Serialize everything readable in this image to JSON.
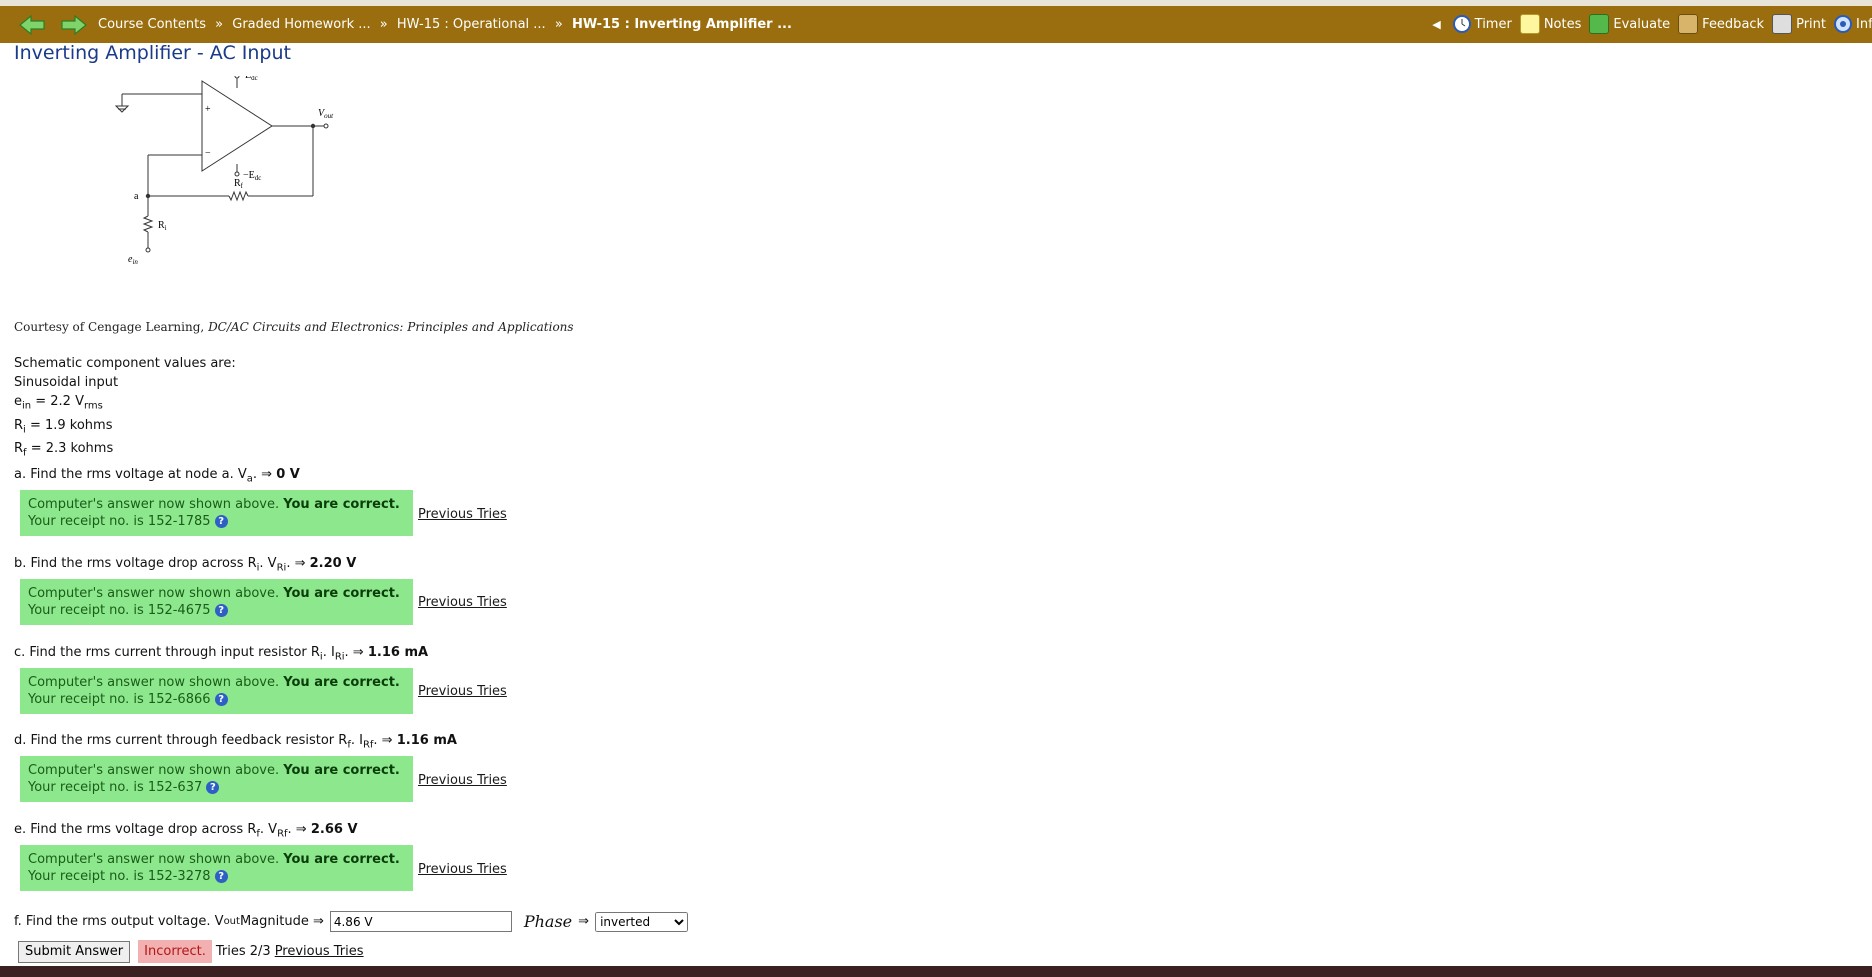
{
  "nav": {
    "breadcrumbs": [
      "Course Contents",
      "Graded Homework ...",
      "HW-15 : Operational ...",
      "HW-15 : Inverting Amplifier ..."
    ],
    "separator": "»",
    "tools": [
      "Timer",
      "Notes",
      "Evaluate",
      "Feedback",
      "Print",
      "Info"
    ]
  },
  "page": {
    "title": "Inverting Amplifier - AC Input"
  },
  "schematic": {
    "edc": "E",
    "edc_sub": "dc",
    "neg_edc": "−E",
    "neg_edc_sub": "dc",
    "vout": "V",
    "vout_sub": "out",
    "rf": "R",
    "rf_sub": "f",
    "ri": "R",
    "ri_sub": "i",
    "node_a": "a",
    "ein": "e",
    "ein_sub": "in",
    "plus": "+",
    "minus": "−"
  },
  "courtesy": {
    "prefix": "Courtesy of Cengage Learning,",
    "book": "DC/AC Circuits and Electronics: Principles and Applications"
  },
  "values": {
    "heading": "Schematic component values are:",
    "sinusoidal": "Sinusoidal input",
    "ein_label": "e",
    "ein_sub": "in",
    "ein_val": " = 2.2 V",
    "ein_unit": "rms",
    "ri_label": "R",
    "ri_sub": "i",
    "ri_val": " = 1.9 kohms",
    "rf_label": "R",
    "rf_sub": "f",
    "rf_val": " = 2.3 kohms"
  },
  "questions": [
    {
      "pre": "a. Find the rms voltage at node a. V",
      "sub1": "a",
      "mid": "",
      "sub2": "",
      "post": ". ⇒",
      "answer": "0 V",
      "receipt": "Your receipt no. is 152-1785"
    },
    {
      "pre": "b. Find the rms voltage drop across R",
      "sub1": "i",
      "mid": ". V",
      "sub2": "Ri",
      "post": ". ⇒",
      "answer": "2.20 V",
      "receipt": "Your receipt no. is 152-4675"
    },
    {
      "pre": "c. Find the rms current through input resistor R",
      "sub1": "i",
      "mid": ". I",
      "sub2": "Ri",
      "post": ". ⇒",
      "answer": "1.16 mA",
      "receipt": "Your receipt no. is 152-6866"
    },
    {
      "pre": "d. Find the rms current through feedback resistor R",
      "sub1": "f",
      "mid": ". I",
      "sub2": "Rf",
      "post": ". ⇒",
      "answer": "1.16 mA",
      "receipt": "Your receipt no. is 152-637"
    },
    {
      "pre": "e. Find the rms voltage drop across R",
      "sub1": "f",
      "mid": ". V",
      "sub2": "Rf",
      "post": ". ⇒",
      "answer": "2.66 V",
      "receipt": "Your receipt no. is 152-3278"
    }
  ],
  "feedback": {
    "shown": "Computer's answer now shown above.",
    "correct": "You are correct.",
    "help": "?",
    "previous_tries": "Previous Tries"
  },
  "partf": {
    "pre": "f. Find the rms output voltage. V",
    "sub": "out",
    "post": " Magnitude ⇒",
    "magnitude": "4.86 V",
    "phase_label": "Phase",
    "phase_arrow": "⇒",
    "phase_value": "inverted",
    "submit": "Submit Answer",
    "status": "Incorrect.",
    "tries": "Tries 2/3",
    "previous_tries": "Previous Tries"
  },
  "colors": {
    "nav": "#9a6e0e",
    "correct_bg": "#8de88d",
    "incorrect_bg": "#f3b0b0",
    "title": "#1a3a8a"
  }
}
